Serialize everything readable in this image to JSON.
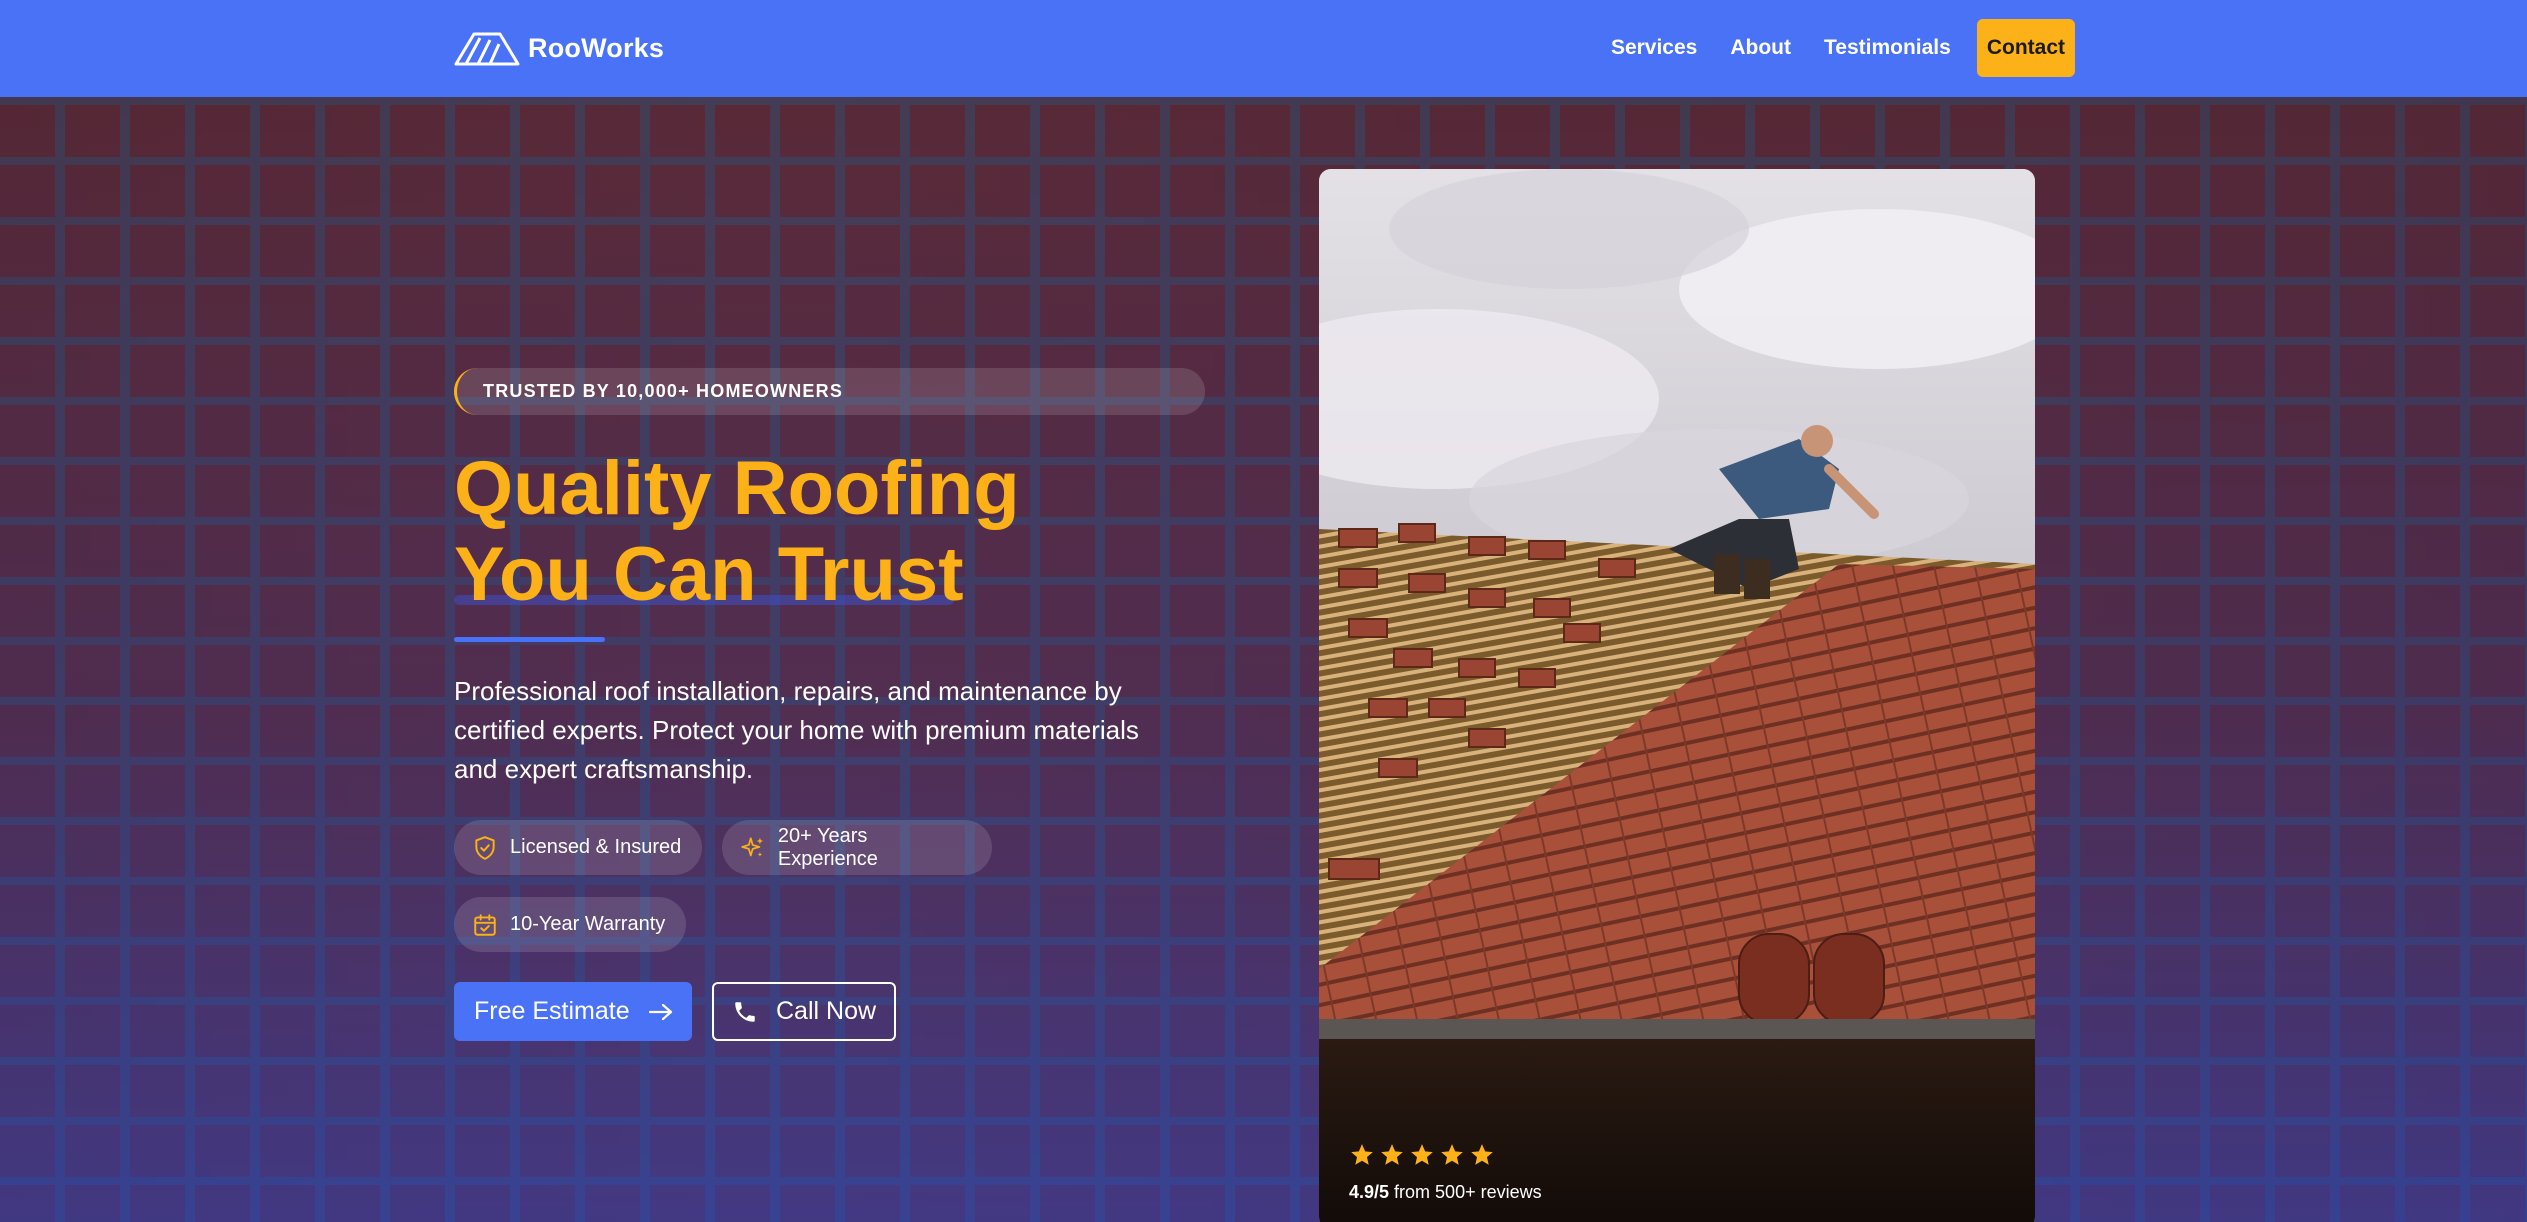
{
  "brand": {
    "name": "RooWorks"
  },
  "nav": {
    "links": [
      "Services",
      "About",
      "Testimonials"
    ],
    "contact_label": "Contact"
  },
  "hero": {
    "trust_label": "TRUSTED BY 10,000+ HOMEOWNERS",
    "headline_line1": "Quality Roofing",
    "headline_line2": "You Can Trust",
    "description": "Professional roof installation, repairs, and maintenance by certified experts. Protect your home with premium materials and expert craftsmanship.",
    "badges": [
      {
        "label": "Licensed & Insured",
        "icon": "shield-icon"
      },
      {
        "label": "20+ Years Experience",
        "icon": "sparkle-icon"
      },
      {
        "label": "10-Year Warranty",
        "icon": "calendar-check-icon"
      }
    ],
    "primary_cta": "Free Estimate",
    "secondary_cta": "Call Now"
  },
  "photo_card": {
    "rating_value": "4.9/5",
    "rating_suffix": " from 500+ reviews",
    "stars": 5
  },
  "colors": {
    "primary": "#4a72f7",
    "accent": "#fbb117",
    "text_light": "#ffffff"
  }
}
